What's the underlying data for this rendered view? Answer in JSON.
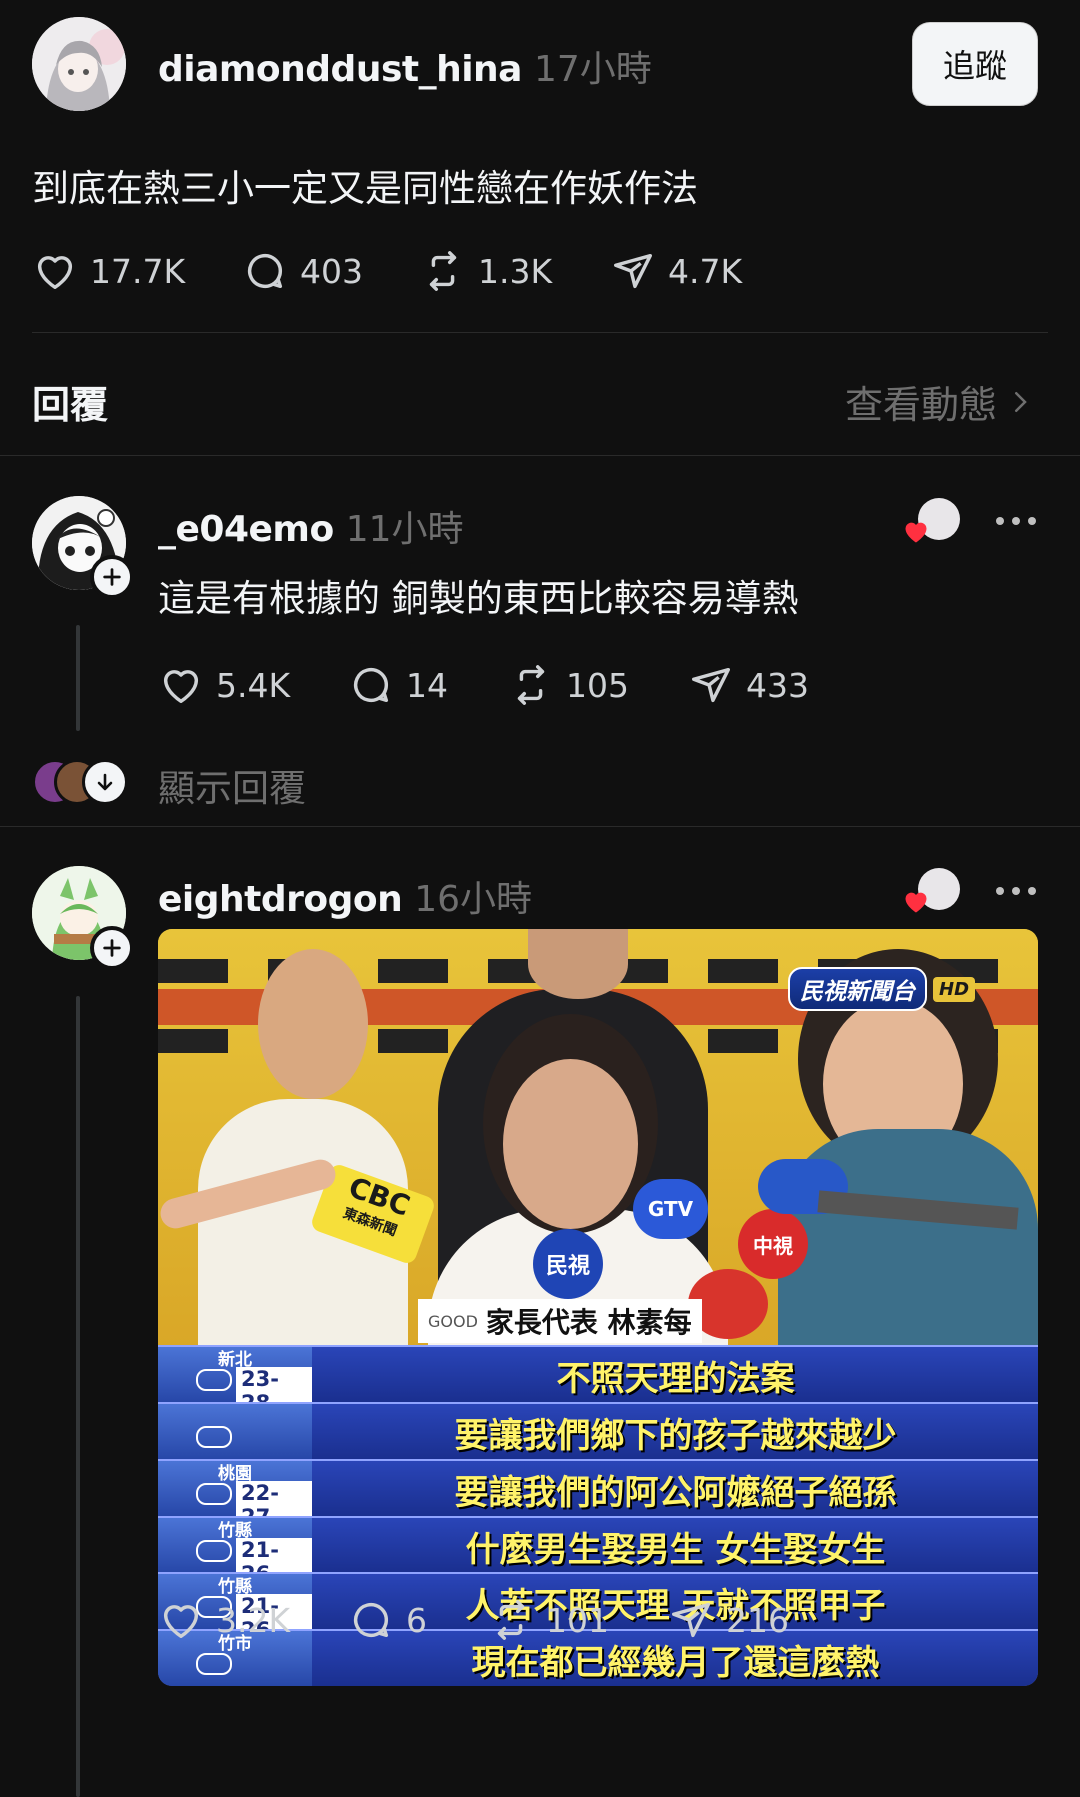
{
  "post": {
    "username": "diamonddust_hina",
    "time": "17小時",
    "follow_label": "追蹤",
    "text": "到底在熱三小一定又是同性戀在作妖作法",
    "likes": "17.7K",
    "comments": "403",
    "reposts": "1.3K",
    "shares": "4.7K"
  },
  "replies_header": {
    "title": "回覆",
    "view_activity": "查看動態"
  },
  "reply1": {
    "username": "_e04emo",
    "time": "11小時",
    "text": "這是有根據的 銅製的東西比較容易導熱",
    "likes": "5.4K",
    "comments": "14",
    "reposts": "105",
    "shares": "433",
    "show_replies": "顯示回覆"
  },
  "reply2": {
    "username": "eightdrogon",
    "time": "16小時",
    "likes": "3.2K",
    "comments": "6",
    "reposts": "101",
    "shares": "216",
    "image": {
      "channel": "民視新聞台",
      "hd": "HD",
      "caption_name": "家長代表 林素每",
      "mic_cbc": "CBC",
      "mic_cbc_sub": "東森新聞",
      "mic_ftv": "民視",
      "mic_ctv": "中視",
      "mic_gtv": "GTV",
      "good": "GOOD",
      "weather": [
        {
          "city": "新北",
          "temp": "23-28"
        },
        {
          "city": "",
          "temp": ""
        },
        {
          "city": "桃園",
          "temp": "22-27"
        },
        {
          "city": "竹縣",
          "temp": "21-26"
        },
        {
          "city": "竹縣",
          "temp": "21-26"
        },
        {
          "city": "竹市",
          "temp": ""
        }
      ],
      "subtitles": [
        "不照天理的法案",
        "要讓我們鄉下的孩子越來越少",
        "要讓我們的阿公阿嬤絕子絕孫",
        "什麼男生娶男生 女生娶女生",
        "人若不照天理 天就不照甲子",
        "現在都已經幾月了還這麼熱"
      ]
    }
  },
  "colors": {
    "background": "#101010",
    "text_primary": "#f3f5f7",
    "text_secondary": "#6f6f6f",
    "heart_red": "#ff3040"
  }
}
